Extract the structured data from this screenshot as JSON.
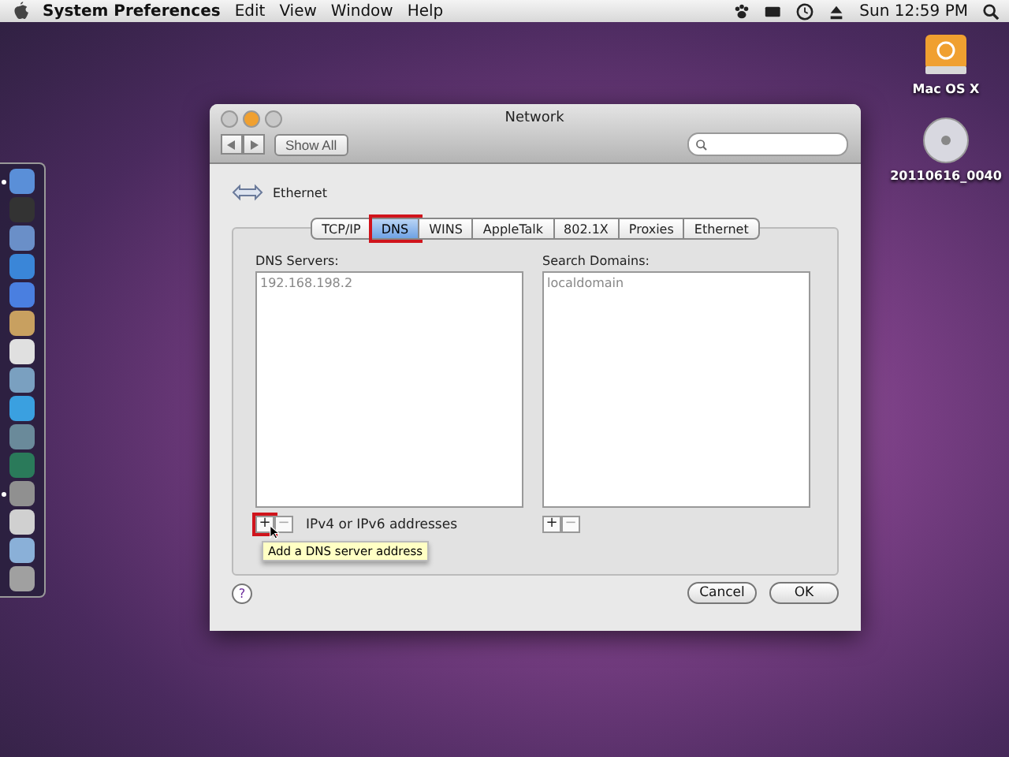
{
  "menubar": {
    "app_name": "System Preferences",
    "menus": [
      "Edit",
      "View",
      "Window",
      "Help"
    ],
    "clock": "Sun 12:59 PM"
  },
  "desktop_icons": [
    {
      "label": "Mac OS X",
      "kind": "drive"
    },
    {
      "label": "20110616_0040",
      "kind": "disc"
    }
  ],
  "dock": {
    "items": [
      {
        "color": "#5a8fd8",
        "running": true
      },
      {
        "color": "#333333",
        "running": false
      },
      {
        "color": "#6a8fc8",
        "running": false
      },
      {
        "color": "#3a86d8",
        "running": false
      },
      {
        "color": "#4a7fe0",
        "running": false
      },
      {
        "color": "#c8a060",
        "running": false
      },
      {
        "color": "#e0e0e0",
        "running": false
      },
      {
        "color": "#7aa0c0",
        "running": false
      },
      {
        "color": "#3aa0e0",
        "running": false
      },
      {
        "color": "#6a8a9a",
        "running": false
      },
      {
        "color": "#2a7a5a",
        "running": false
      },
      {
        "color": "#909090",
        "running": true
      },
      {
        "color": "#d0d0d0",
        "running": false
      },
      {
        "color": "#8ab0d8",
        "running": false
      },
      {
        "color": "#a0a0a0",
        "running": false
      }
    ]
  },
  "window": {
    "title": "Network",
    "show_all": "Show All",
    "service": "Ethernet",
    "tabs": [
      {
        "label": "TCP/IP",
        "selected": false,
        "highlighted": false
      },
      {
        "label": "DNS",
        "selected": true,
        "highlighted": true
      },
      {
        "label": "WINS",
        "selected": false,
        "highlighted": false
      },
      {
        "label": "AppleTalk",
        "selected": false,
        "highlighted": false
      },
      {
        "label": "802.1X",
        "selected": false,
        "highlighted": false
      },
      {
        "label": "Proxies",
        "selected": false,
        "highlighted": false
      },
      {
        "label": "Ethernet",
        "selected": false,
        "highlighted": false
      }
    ],
    "dns_servers": {
      "label": "DNS Servers:",
      "entries": [
        "192.168.198.2"
      ],
      "add": "+",
      "remove": "−",
      "add_highlighted": true,
      "hint": "IPv4 or IPv6 addresses"
    },
    "search_domains": {
      "label": "Search Domains:",
      "entries": [
        "localdomain"
      ],
      "add": "+",
      "remove": "−"
    },
    "tooltip": "Add a DNS server address",
    "help": "?",
    "buttons": [
      {
        "label": "Cancel",
        "default": false
      },
      {
        "label": "OK",
        "default": false
      }
    ]
  }
}
